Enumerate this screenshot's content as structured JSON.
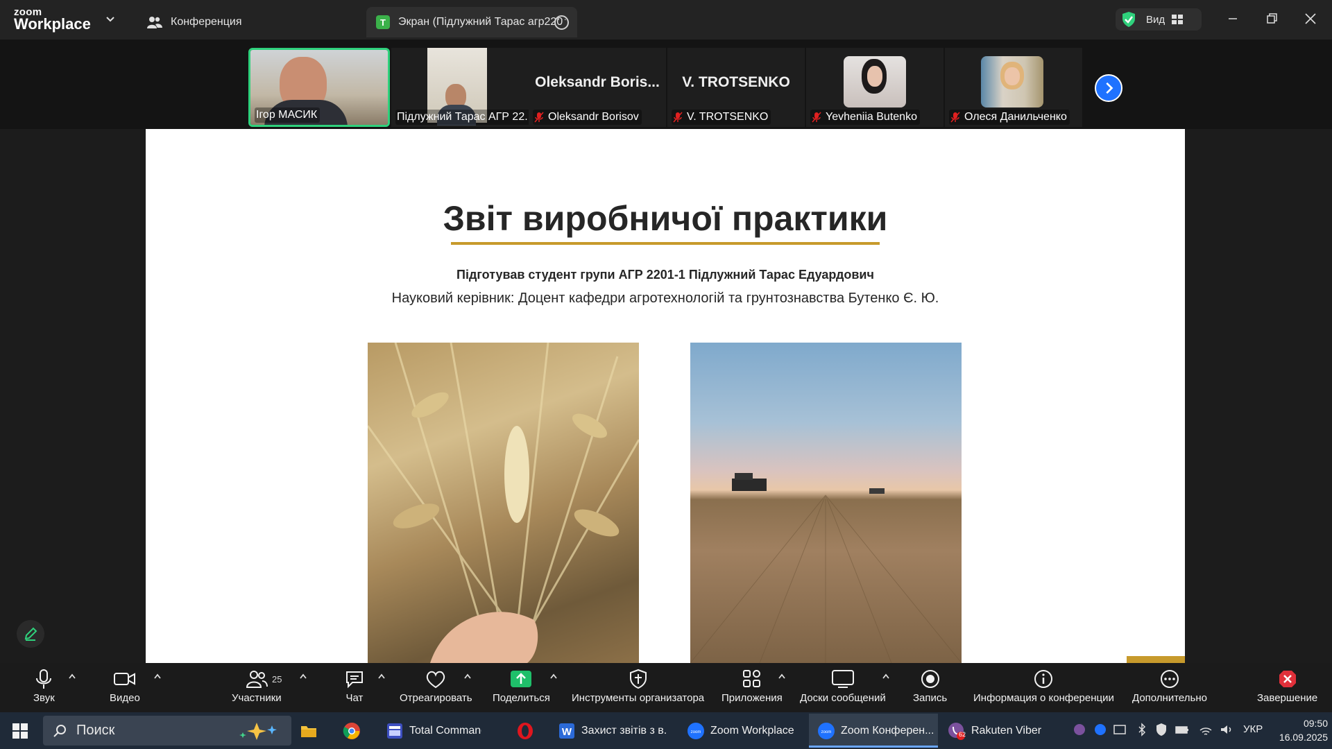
{
  "app": {
    "brand_small": "zoom",
    "brand_large": "Workplace"
  },
  "tabs": {
    "meeting": "Конференция",
    "share_tag": "T",
    "share": "Экран (Підлужний Тарас агр220"
  },
  "view": {
    "label": "Вид"
  },
  "participants": [
    {
      "name": "Ігор МАСИК",
      "muted": false,
      "video": true
    },
    {
      "name": "Підлужний Тарас АГР 22...",
      "muted": false,
      "video": true
    },
    {
      "name": "Oleksandr Borisov",
      "display_name": "Oleksandr  Boris...",
      "muted": true,
      "video": false
    },
    {
      "name": "V. TROTSENKO",
      "display_name": "V. TROTSENKO",
      "muted": true,
      "video": false
    },
    {
      "name": "Yevheniia Butenko",
      "muted": true,
      "video": false
    },
    {
      "name": "Олеся Данильченко",
      "muted": true,
      "video": false
    }
  ],
  "slide": {
    "title": "Звіт виробничої практики",
    "prepared_by": "Підготував студент групи АГР 2201-1 Підлужний Тарас Едуардович",
    "supervisor": "Науковий керівник: Доцент кафедри агротехнологій та грунтознавства Бутенко Є. Ю.",
    "accent_color": "#c79a2c"
  },
  "toolbar": {
    "audio": "Звук",
    "video": "Видео",
    "participants": "Участники",
    "participants_count": "25",
    "chat": "Чат",
    "react": "Отреагировать",
    "share": "Поделиться",
    "host_tools": "Инструменты организатора",
    "apps": "Приложения",
    "whiteboards": "Доски сообщений",
    "record": "Запись",
    "meeting_info": "Информация о конференции",
    "more": "Дополнительно",
    "end": "Завершение"
  },
  "taskbar": {
    "search_placeholder": "Поиск",
    "items": [
      {
        "label": "Total Commande..."
      },
      {
        "label": "Захист звітів з в..."
      },
      {
        "label": "Zoom Workplace"
      },
      {
        "label": "Zoom Конферен..."
      },
      {
        "label": "Rakuten Viber"
      }
    ],
    "viber_badge": "62",
    "language": "УКР",
    "time": "09:50",
    "date": "16.09.2025"
  },
  "colors": {
    "active_speaker": "#2fd17c",
    "share_green": "#1fbf6a",
    "end_red": "#e0303a",
    "zoom_blue": "#1f72ff"
  }
}
